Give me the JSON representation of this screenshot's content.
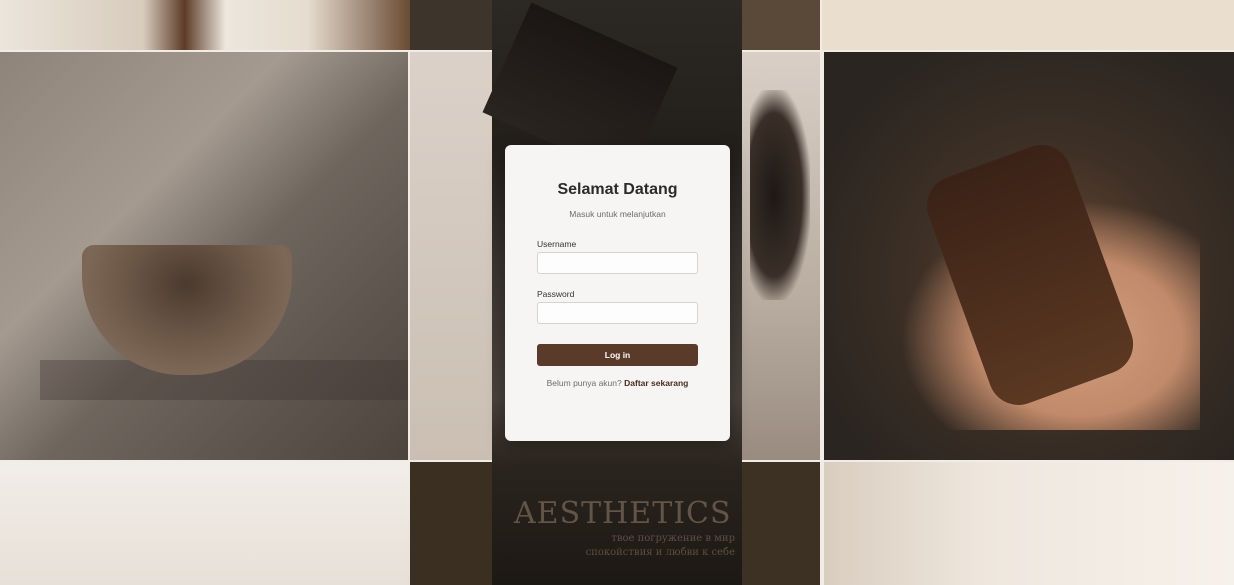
{
  "login": {
    "title": "Selamat Datang",
    "subtitle": "Masuk untuk melanjutkan",
    "username_label": "Username",
    "username_value": "",
    "password_label": "Password",
    "password_value": "",
    "login_button": "Log in",
    "register_prompt": "Belum punya akun?",
    "register_link": "Daftar sekarang"
  },
  "background": {
    "poster_title": "AESTHETICS",
    "poster_subtitle": "твое погружение в мир спокойствия и любви к себе"
  },
  "colors": {
    "accent": "#5a3a28",
    "card_background": "#f6f5f4"
  }
}
